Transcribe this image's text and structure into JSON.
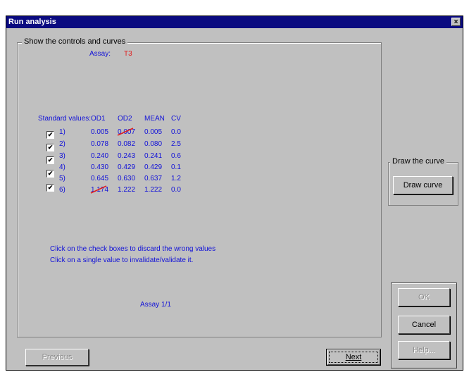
{
  "window": {
    "title": "Run analysis",
    "close_glyph": "×"
  },
  "main_group": {
    "legend": "Show the controls and curves",
    "assay_label": "Assay:",
    "assay_value": "T3",
    "table": {
      "row_label_header": "Standard values:",
      "columns": [
        "OD1",
        "OD2",
        "MEAN",
        "CV"
      ],
      "rows": [
        {
          "checked": true,
          "label": "1)",
          "od1": "0.005",
          "od2": "0.007",
          "mean": "0.005",
          "cv": "0.0",
          "struck": "od2"
        },
        {
          "checked": true,
          "label": "2)",
          "od1": "0.078",
          "od2": "0.082",
          "mean": "0.080",
          "cv": "2.5",
          "struck": null
        },
        {
          "checked": true,
          "label": "3)",
          "od1": "0.240",
          "od2": "0.243",
          "mean": "0.241",
          "cv": "0.6",
          "struck": null
        },
        {
          "checked": true,
          "label": "4)",
          "od1": "0.430",
          "od2": "0.429",
          "mean": "0.429",
          "cv": "0.1",
          "struck": null
        },
        {
          "checked": true,
          "label": "5)",
          "od1": "0.645",
          "od2": "0.630",
          "mean": "0.637",
          "cv": "1.2",
          "struck": null
        },
        {
          "checked": true,
          "label": "6)",
          "od1": "1.174",
          "od2": "1.222",
          "mean": "1.222",
          "cv": "0.0",
          "struck": "od1"
        }
      ]
    },
    "instructions": [
      "Click on the check boxes to discard the wrong values",
      "Click on a single value to invalidate/validate it."
    ],
    "assay_counter": "Assay 1/1"
  },
  "draw_group": {
    "legend": "Draw the curve",
    "button_label": "Draw curve"
  },
  "side_buttons": {
    "ok": "OK",
    "cancel": "Cancel",
    "help": "Help..."
  },
  "nav": {
    "previous": "Previous",
    "next": "Next"
  },
  "colors": {
    "title_bar": "#0a0a80",
    "dialog_bg": "#c0c0c0",
    "data_text": "#1010d8",
    "assay_value": "#e02020",
    "strike": "#e02020"
  }
}
